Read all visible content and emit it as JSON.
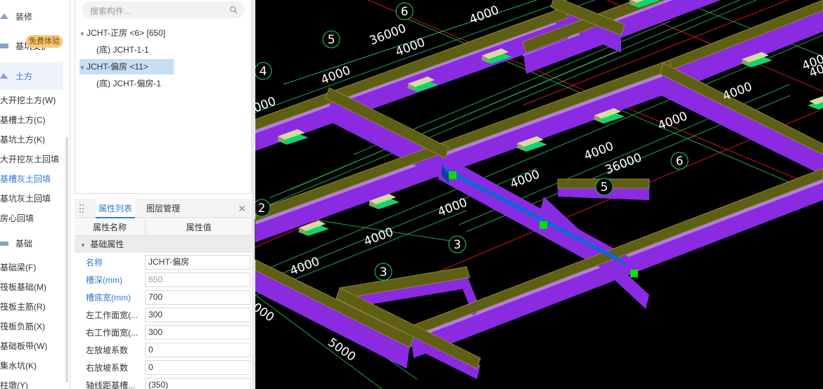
{
  "nav": {
    "categories": [
      {
        "label": "装修",
        "icon": "decoration-icon"
      },
      {
        "label": "基坑支护",
        "icon": "foundation-pit-icon"
      },
      {
        "label": "土方",
        "icon": "earthwork-icon"
      },
      {
        "label": "基础",
        "icon": "foundation-icon"
      }
    ],
    "promo": "免费体验",
    "earthwork_items": [
      "大开挖土方(W)",
      "基槽土方(C)",
      "基坑土方(K)",
      "大开挖灰土回填",
      "基槽灰土回填",
      "基坑灰土回填",
      "房心回填"
    ],
    "foundation_items": [
      "基础梁(F)",
      "筏板基础(M)",
      "筏板主筋(R)",
      "筏板负筋(X)",
      "基础板带(W)",
      "集水坑(K)",
      "柱墩(Y)"
    ]
  },
  "tree": {
    "search_placeholder": "搜索构件...",
    "nodes": [
      {
        "label": "JCHT-正房 <6> [650]"
      },
      {
        "label": "(底) JCHT-1-1"
      },
      {
        "label": "JCHT-偏房 <11>"
      },
      {
        "label": "(底) JCHT-偏房-1"
      }
    ]
  },
  "props": {
    "tabs": [
      "属性列表",
      "图层管理"
    ],
    "header": {
      "name": "属性名称",
      "value": "属性值"
    },
    "group": "基础属性",
    "rows": [
      {
        "name": "名称",
        "value": "JCHT-偏房"
      },
      {
        "name": "槽深(mm)",
        "value": "650"
      },
      {
        "name": "槽底宽(mm)",
        "value": "700"
      },
      {
        "name": "左工作面宽(...",
        "value": "300"
      },
      {
        "name": "右工作面宽(...",
        "value": "300"
      },
      {
        "name": "左放坡系数",
        "value": "0"
      },
      {
        "name": "右放坡系数",
        "value": "0"
      },
      {
        "name": "轴线距基槽...",
        "value": "(350)"
      }
    ]
  },
  "viewport": {
    "dimensions": [
      "4000",
      "36000",
      "4000",
      "4000",
      "4000",
      "4000",
      "4000",
      "4000",
      "4000",
      "4000",
      "36000",
      "4000",
      "4000",
      "4000",
      "000",
      "000",
      "5000",
      "4000"
    ],
    "axis_labels": [
      "6",
      "5",
      "4",
      "2",
      "3",
      "6",
      "5",
      "3"
    ]
  },
  "colors": {
    "accent": "#2f7cd6",
    "selected_node": "#c7def5",
    "trench_purple": "#8a2be2",
    "beam_olive": "#6b6b1a",
    "selected_beam": "#1e5fd8",
    "grip_green": "#00e000"
  }
}
